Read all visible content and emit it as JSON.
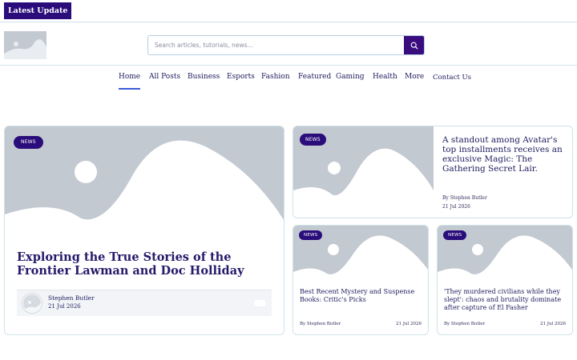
{
  "topbar": {
    "latest_label": "Latest  Update"
  },
  "search": {
    "placeholder": "Search articles, tutorials, news..."
  },
  "nav": {
    "items": [
      "Home",
      "All Posts",
      "Business",
      "Esports",
      "Fashion",
      "Featured",
      "Gaming",
      "Health",
      "More",
      "Contact Us"
    ],
    "active": "Home"
  },
  "posts": [
    {
      "badge": "NEWS",
      "title": "Exploring the True Stories of the Frontier Lawman and Doc Holliday",
      "author": "Stephen Butler",
      "date": "21 Jul 2026"
    },
    {
      "badge": "NEWS",
      "title": "A standout among Avatar's top installments receives an exclusive Magic: The Gathering Secret Lair.",
      "author": "By Stephen Butler",
      "date": "21 Jul 2026"
    },
    {
      "badge": "NEWS",
      "title": "Best Recent Mystery and Suspense Books: Critic's Picks",
      "author": "By Stephen Butler",
      "date": "21 Jul 2026"
    },
    {
      "badge": "NEWS",
      "title": "'They murdered civilians while they slept': chaos and brutality dominate after capture of El Fasher",
      "author": "By Stephen Butler",
      "date": "21 Jul 2026"
    }
  ],
  "colors": {
    "brand": "#2a0c7a",
    "placeholder": "#c3c9d1",
    "text": "#1e1b5e",
    "active_underline": "#3b5bdb"
  },
  "icons": {
    "search": "search-icon"
  }
}
